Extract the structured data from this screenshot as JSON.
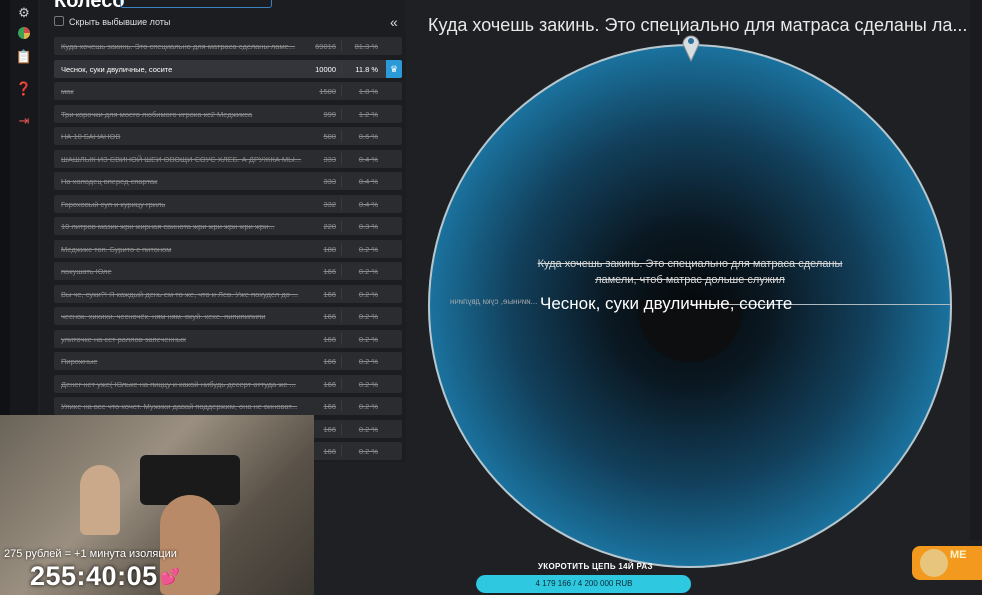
{
  "panel": {
    "title": "Колесо",
    "hide_label": "Скрыть выбывшие лоты",
    "collapse": "«"
  },
  "lots": [
    {
      "name": "Куда хочешь закинь. Это специально для матраса сделаны ламе...",
      "amount": "69016",
      "percent": "81.3 %"
    },
    {
      "name": "Чеснок, суки двуличные, сосите",
      "amount": "10000",
      "percent": "11.8 %",
      "active": true
    },
    {
      "name": "мак",
      "amount": "1500",
      "percent": "1.8 %"
    },
    {
      "name": "Три корочки для моего любимого игрока кс2 Меджикса",
      "amount": "999",
      "percent": "1.2 %"
    },
    {
      "name": "НА 10 БАНАНОВ",
      "amount": "500",
      "percent": "0.6 %"
    },
    {
      "name": "ШАШЛЫК ИЗ СВИНОЙ ШЕИ ОВОЩИ СОУС ХЛЕБ. А ДРУЖКА МЫ...",
      "amount": "333",
      "percent": "0.4 %"
    },
    {
      "name": "На холодец вперед спартак",
      "amount": "333",
      "percent": "0.4 %"
    },
    {
      "name": "Гороховый суп и курицу гриль",
      "amount": "332",
      "percent": "0.4 %"
    },
    {
      "name": "10 литров мазик жри жирная свинота жри жри жри жри жри...",
      "amount": "220",
      "percent": "0.3 %"
    },
    {
      "name": "Меджикс топ. Бурито с питоном",
      "amount": "188",
      "percent": "0.2 %"
    },
    {
      "name": "покушать Юле",
      "amount": "166",
      "percent": "0.2 %"
    },
    {
      "name": "Вы че, суки?! Я каждый день ем то же, что и Лев. Уже похудел до ...",
      "amount": "166",
      "percent": "0.2 %"
    },
    {
      "name": "чеснок. хихихи. чесночёк. ням ням. вкуй. хехе. пипипипипи",
      "amount": "166",
      "percent": "0.2 %"
    },
    {
      "name": "улиточке на сет роллов запеченных",
      "amount": "166",
      "percent": "0.2 %"
    },
    {
      "name": "Пирожные",
      "amount": "166",
      "percent": "0.2 %"
    },
    {
      "name": "Денег нет уже( Юльке на пиццу и какой-нибудь десерт оттуда же ...",
      "amount": "166",
      "percent": "0.2 %"
    },
    {
      "name": "Улике на все что хочет. Мужики давай поддержим, она не виноват...",
      "amount": "166",
      "percent": "0.2 %"
    },
    {
      "name": "",
      "amount": "166",
      "percent": "0.2 %"
    },
    {
      "name": "",
      "amount": "166",
      "percent": "0.2 %"
    }
  ],
  "wheel": {
    "title": "Куда хочешь закинь. Это специально для матраса сделаны ла...",
    "strike_text": "Куда хочешь закинь. Это специально для матраса сделаны ламели, чтоб матрас дольше служил",
    "winner": "Чеснок, суки двуличные, сосите",
    "ghost": "...иичные, суки двуличн"
  },
  "goal": {
    "title": "УКОРОТИТЬ ЦЕПЬ 14Й РАЗ",
    "progress": "4 179 166 / 4 200 000 RUB",
    "fraction": 0.995
  },
  "cam": {
    "isolation": "275 рублей = +1 минута изоляции",
    "timer": "255:40:05"
  },
  "doge": {
    "text": "МЕ"
  },
  "colors": {
    "accent": "#2b9ad8",
    "wheel": "#1f8ab9",
    "goal": "#2ec8e0"
  }
}
